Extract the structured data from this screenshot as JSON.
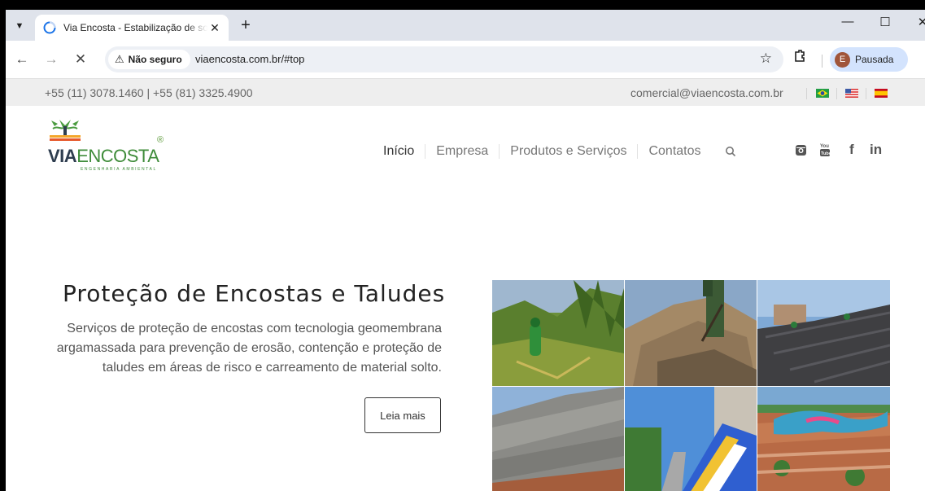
{
  "browser": {
    "tab_title": "Via Encosta - Estabilização de solos",
    "security_label": "Não seguro",
    "url": "viaencosta.com.br/#top",
    "profile_initial": "E",
    "profile_label": "Pausada"
  },
  "topbar": {
    "phones": "+55 (11) 3078.1460 | +55 (81) 3325.4900",
    "email": "comercial@viaencosta.com.br",
    "flags": [
      "brazil-flag",
      "usa-flag",
      "spain-flag"
    ]
  },
  "logo": {
    "via": "VIA",
    "encosta": "ENCOSTA",
    "tagline": "ENGENHARIA AMBIENTAL",
    "registered": "®"
  },
  "nav": {
    "items": [
      "Início",
      "Empresa",
      "Produtos e Serviços",
      "Contatos"
    ]
  },
  "social": {
    "icons": [
      "instagram-icon",
      "youtube-icon",
      "facebook-icon",
      "linkedin-icon"
    ],
    "facebook": "f",
    "linkedin": "in"
  },
  "hero": {
    "title": "Proteção de Encostas e Taludes",
    "text": "Serviços de proteção de encostas com tecnologia geomembrana argamassada para prevenção de erosão, contenção e proteção de taludes em áreas de risco e carreamento de material solto.",
    "button": "Leia mais"
  },
  "colors": {
    "logo_green": "#3f8c3a",
    "logo_navy": "#2e3d4f",
    "tab_strip": "#dfe3eb",
    "profile_chip": "#d3e3fd"
  }
}
